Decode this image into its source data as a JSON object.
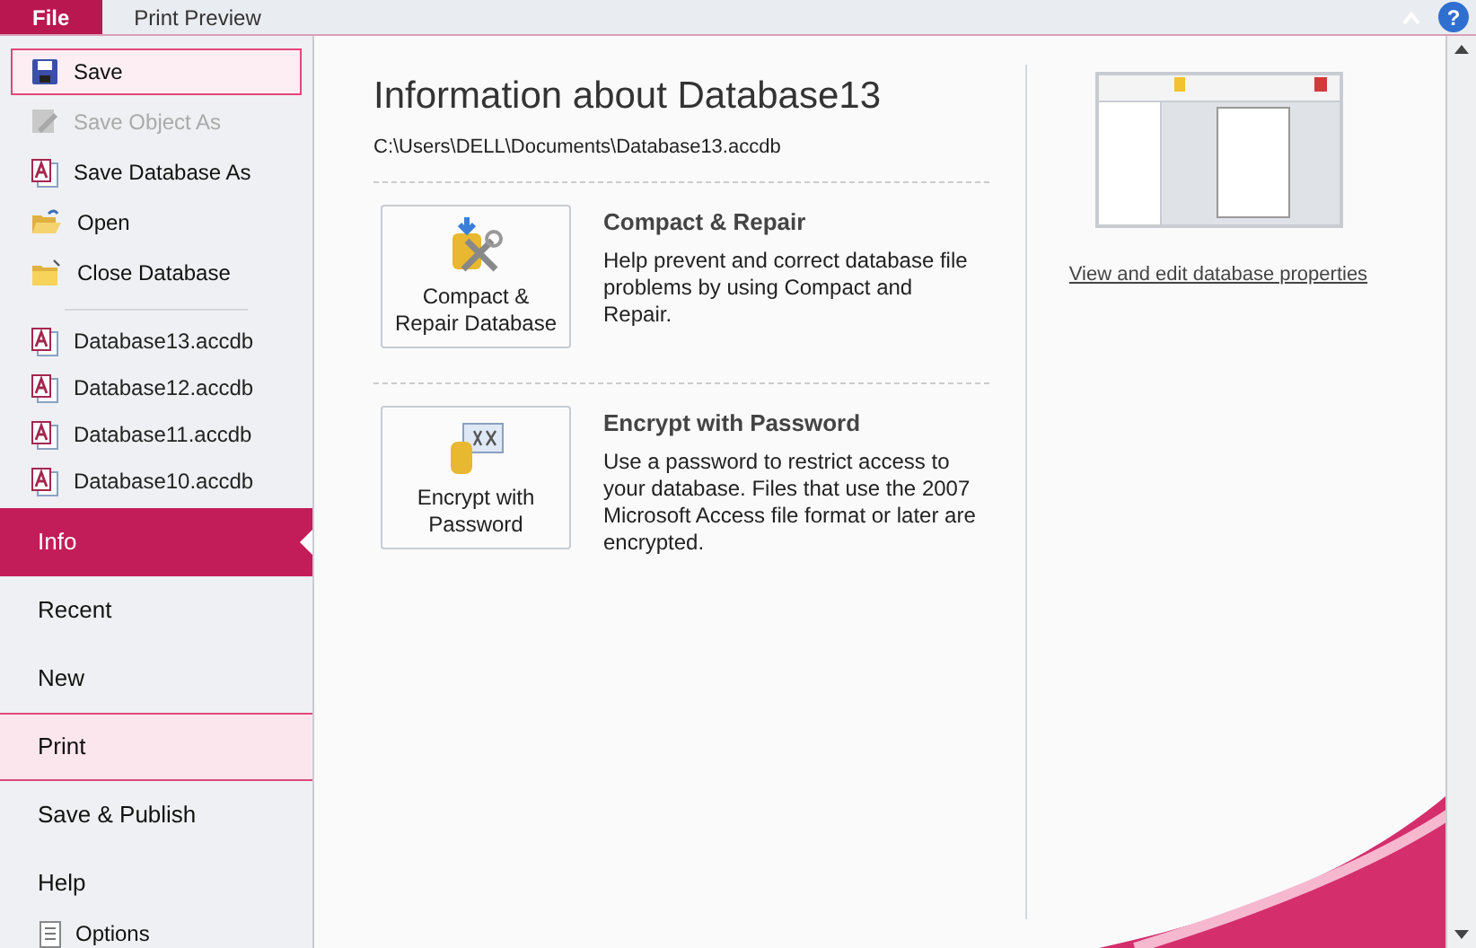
{
  "tabs": [
    {
      "label": "File",
      "selected": true
    },
    {
      "label": "Print Preview",
      "selected": false
    }
  ],
  "commands": [
    {
      "label": "Save",
      "kind": "save",
      "disabled": false,
      "highlighted": true
    },
    {
      "label": "Save Object As",
      "kind": "save-object",
      "disabled": true,
      "highlighted": false
    },
    {
      "label": "Save Database As",
      "kind": "database",
      "disabled": false,
      "highlighted": false
    },
    {
      "label": "Open",
      "kind": "open",
      "disabled": false,
      "highlighted": false
    },
    {
      "label": "Close Database",
      "kind": "close",
      "disabled": false,
      "highlighted": false
    }
  ],
  "recent_files": [
    "Database13.accdb",
    "Database12.accdb",
    "Database11.accdb",
    "Database10.accdb"
  ],
  "nav": [
    {
      "label": "Info",
      "selected": true,
      "highlighted": false
    },
    {
      "label": "Recent",
      "selected": false,
      "highlighted": false
    },
    {
      "label": "New",
      "selected": false,
      "highlighted": false
    },
    {
      "label": "Print",
      "selected": false,
      "highlighted": true
    },
    {
      "label": "Save & Publish",
      "selected": false,
      "highlighted": false
    },
    {
      "label": "Help",
      "selected": false,
      "highlighted": false
    }
  ],
  "options": "Options",
  "help_button": "?",
  "info": {
    "title": "Information about Database13",
    "path": "C:\\Users\\DELL\\Documents\\Database13.accdb",
    "sections": [
      {
        "kind": "compact",
        "button_label": "Compact & Repair Database",
        "heading": "Compact & Repair",
        "description": "Help prevent and correct database file problems by using Compact and Repair."
      },
      {
        "kind": "encrypt",
        "button_label": "Encrypt with Password",
        "heading": "Encrypt with Password",
        "description": "Use a password to restrict access to your database. Files that use the 2007 Microsoft Access file format or later are encrypted."
      }
    ]
  },
  "properties_link": "View and edit database properties"
}
